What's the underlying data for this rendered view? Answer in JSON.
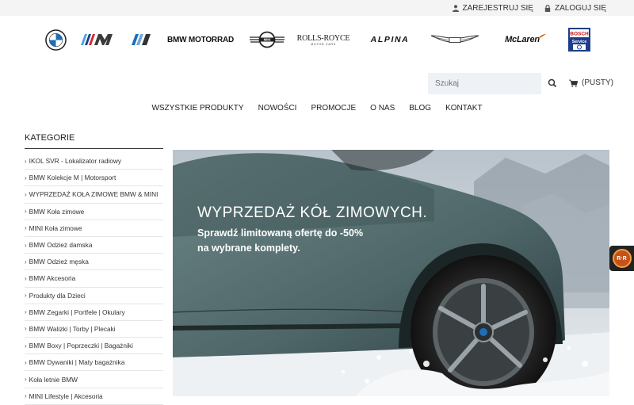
{
  "topbar": {
    "register_label": "ZAREJESTRUJ SIĘ",
    "login_label": "ZALOGUJ SIĘ"
  },
  "brands": [
    {
      "name": "BMW",
      "icon": "bmw-roundel-icon"
    },
    {
      "name": "BMW M",
      "icon": "bmw-m-logo-icon"
    },
    {
      "name": "BMW i",
      "icon": "bmw-i-logo-icon"
    },
    {
      "name": "BMW MOTORRAD",
      "icon": "bmw-motorrad-logo"
    },
    {
      "name": "MINI",
      "icon": "mini-logo-icon"
    },
    {
      "name": "ROLLS-ROYCE",
      "sub": "MOTOR CARS",
      "icon": "rolls-royce-logo"
    },
    {
      "name": "ALPINA",
      "icon": "alpina-logo"
    },
    {
      "name": "Aston Martin",
      "icon": "aston-martin-wings-icon"
    },
    {
      "name": "McLaren",
      "icon": "mclaren-logo"
    },
    {
      "name": "BOSCH Service",
      "icon": "bosch-service-logo"
    }
  ],
  "search": {
    "placeholder": "Szukaj"
  },
  "cart": {
    "label": "(PUSTY)"
  },
  "nav": [
    "WSZYSTKIE PRODUKTY",
    "NOWOŚCI",
    "PROMOCJE",
    "O NAS",
    "BLOG",
    "KONTAKT"
  ],
  "sidebar": {
    "title": "KATEGORIE",
    "items": [
      "IKOL SVR - Lokalizator radiowy",
      "BMW Kolekcje M | Motorsport",
      "WYPRZEDAŻ KOŁA ZIMOWE BMW & MINI",
      "BMW Koła zimowe",
      "MINI Koła zimowe",
      "BMW Odzież damska",
      "BMW Odzież męska",
      "BMW Akcesoria",
      "Produkty dla Dzieci",
      "BMW Zegarki | Portfele | Okulary",
      "BMW Walizki | Torby | Plecaki",
      "BMW Boxy | Poprzeczki | Bagażniki",
      "BMW Dywaniki | Maty bagażnika",
      "Koła letnie BMW",
      "MINI Lifestyle | Akcesoria"
    ]
  },
  "hero": {
    "title": "WYPRZEDAŻ KÓŁ ZIMOWYCH.",
    "subtitle_line1": "Sprawdź limitowaną ofertę do -50%",
    "subtitle_line2": "na wybrane komplety."
  },
  "badge": {
    "label": "R·R"
  },
  "colors": {
    "accent": "#1c6fb8",
    "topbar_bg": "#f4f4f4",
    "search_bg": "#eef1f6"
  }
}
